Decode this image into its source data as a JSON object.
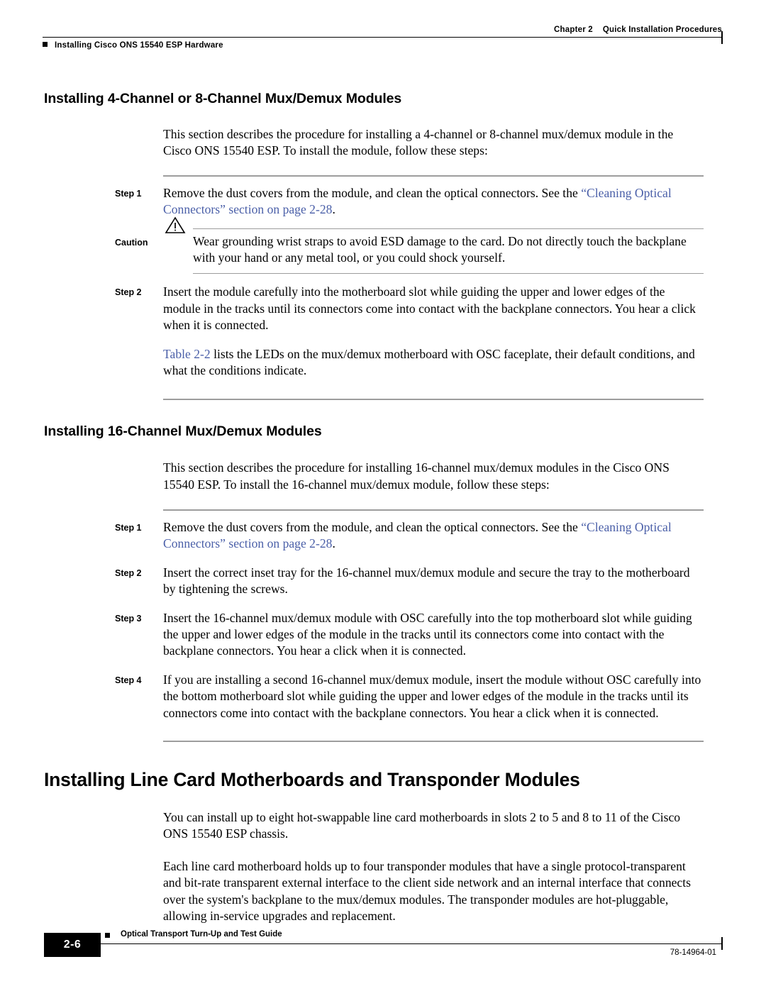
{
  "header": {
    "chapter_label": "Chapter 2",
    "chapter_title": "Quick Installation Procedures",
    "running_title": "Installing Cisco ONS 15540 ESP Hardware"
  },
  "sections": [
    {
      "heading": "Installing 4-Channel or 8-Channel Mux/Demux Modules",
      "intro": "This section describes the procedure for installing a 4-channel or 8-channel mux/demux module in the Cisco ONS 15540 ESP. To install the module, follow these steps:",
      "step1_label": "Step 1",
      "step1_text_a": "Remove the dust covers from the module, and clean the optical connectors. See the ",
      "step1_xref": "“Cleaning Optical Connectors” section on page 2-28",
      "step1_text_b": ".",
      "caution_label": "Caution",
      "caution_text": "Wear grounding wrist straps to avoid ESD damage to the card. Do not directly touch the backplane with your hand or any metal tool, or you could shock yourself.",
      "step2_label": "Step 2",
      "step2_text": "Insert the module carefully into the motherboard slot while guiding the upper and lower edges of the module in the tracks until its connectors come into contact with the backplane connectors. You hear a click when it is connected.",
      "table_xref": "Table 2-2",
      "table_text": " lists the LEDs on the mux/demux motherboard with OSC faceplate, their default conditions, and what the conditions indicate."
    },
    {
      "heading": "Installing 16-Channel Mux/Demux Modules",
      "intro": "This section describes the procedure for installing 16-channel mux/demux modules in the Cisco ONS 15540 ESP. To install the 16-channel mux/demux module, follow these steps:",
      "steps": [
        {
          "label": "Step 1",
          "text_a": "Remove the dust covers from the module, and clean the optical connectors. See the ",
          "xref": "“Cleaning Optical Connectors” section on page 2-28",
          "text_b": "."
        },
        {
          "label": "Step 2",
          "text_a": "Insert the correct inset tray for the 16-channel mux/demux module and secure the tray to the motherboard by tightening the screws.",
          "xref": "",
          "text_b": ""
        },
        {
          "label": "Step 3",
          "text_a": "Insert the 16-channel mux/demux module with OSC carefully into the top motherboard slot while guiding the upper and lower edges of the module in the tracks until its connectors come into contact with the backplane connectors. You hear a click when it is connected.",
          "xref": "",
          "text_b": ""
        },
        {
          "label": "Step 4",
          "text_a": "If you are installing a second 16-channel mux/demux module, insert the module without OSC carefully into the bottom motherboard slot while guiding the upper and lower edges of the module in the tracks until its connectors come into contact with the backplane connectors. You hear a click when it is connected.",
          "xref": "",
          "text_b": ""
        }
      ]
    }
  ],
  "chapter_section": {
    "heading": "Installing Line Card Motherboards and Transponder Modules",
    "paragraph1": "You can install up to eight hot-swappable line card motherboards in slots 2 to 5 and 8 to 11 of the Cisco ONS 15540 ESP chassis.",
    "paragraph2": "Each line card motherboard holds up to four transponder modules that have a single protocol-transparent and bit-rate transparent external interface to the client side network and an internal interface that connects over the system's backplane to the mux/demux modules. The transponder modules are hot-pluggable, allowing in-service upgrades and replacement."
  },
  "footer": {
    "guide_title": "Optical Transport Turn-Up and Test Guide",
    "page_number": "2-6",
    "doc_number": "78-14964-01"
  },
  "colors": {
    "xref": "#4a5fa8",
    "rule": "#9d9d9d",
    "text": "#000000"
  }
}
